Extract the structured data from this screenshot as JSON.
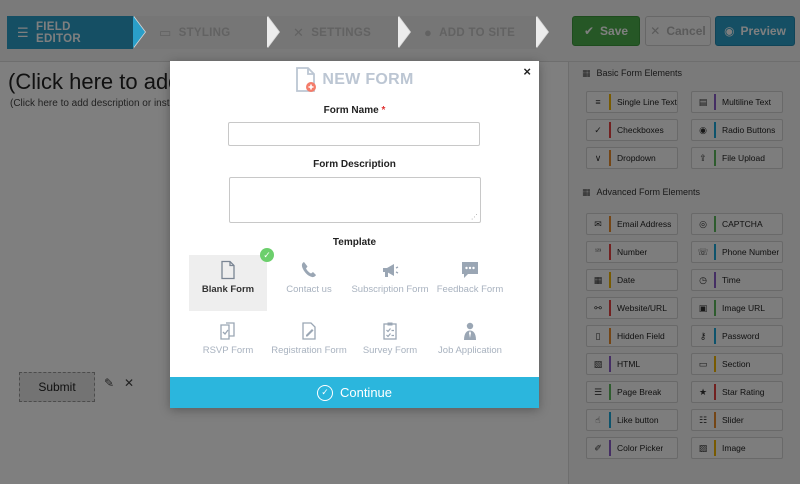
{
  "steps": [
    {
      "label": "FIELD EDITOR",
      "icon": "list-icon"
    },
    {
      "label": "STYLING",
      "icon": "paint-roller-icon"
    },
    {
      "label": "SETTINGS",
      "icon": "tools-icon"
    },
    {
      "label": "ADD TO SITE",
      "icon": "globe-icon"
    }
  ],
  "buttons": {
    "save": "Save",
    "cancel": "Cancel",
    "preview": "Preview"
  },
  "canvas": {
    "title": "(Click here to add",
    "description": "(Click here to add description or inst",
    "submit_label": "Submit"
  },
  "sidebar": {
    "basic_title": "Basic Form Elements",
    "basic": [
      {
        "label": "Single Line Text",
        "icon": "lines-icon",
        "color": "#f0b400"
      },
      {
        "label": "Multiline Text",
        "icon": "paragraph-icon",
        "color": "#8a5cc8"
      },
      {
        "label": "Checkboxes",
        "icon": "check-icon",
        "color": "#e54040"
      },
      {
        "label": "Radio Buttons",
        "icon": "radio-icon",
        "color": "#1aa6d9"
      },
      {
        "label": "Dropdown",
        "icon": "chevron-down-icon",
        "color": "#e88a2a"
      },
      {
        "label": "File Upload",
        "icon": "upload-icon",
        "color": "#5cb85c"
      }
    ],
    "advanced_title": "Advanced Form Elements",
    "advanced": [
      {
        "label": "Email Address",
        "icon": "envelope-icon",
        "color": "#e88a2a"
      },
      {
        "label": "CAPTCHA",
        "icon": "eye-icon",
        "color": "#5cb85c"
      },
      {
        "label": "Number",
        "icon": "number-icon",
        "color": "#e54040"
      },
      {
        "label": "Phone Number",
        "icon": "phone-icon",
        "color": "#1aa6d9"
      },
      {
        "label": "Date",
        "icon": "calendar-icon",
        "color": "#f0b400"
      },
      {
        "label": "Time",
        "icon": "clock-icon",
        "color": "#8a5cc8"
      },
      {
        "label": "Website/URL",
        "icon": "link-icon",
        "color": "#e54040"
      },
      {
        "label": "Image URL",
        "icon": "image-icon",
        "color": "#5cb85c"
      },
      {
        "label": "Hidden Field",
        "icon": "hidden-icon",
        "color": "#e88a2a"
      },
      {
        "label": "Password",
        "icon": "key-icon",
        "color": "#1aa6d9"
      },
      {
        "label": "HTML",
        "icon": "html-icon",
        "color": "#8a5cc8"
      },
      {
        "label": "Section",
        "icon": "section-icon",
        "color": "#f0b400"
      },
      {
        "label": "Page Break",
        "icon": "page-break-icon",
        "color": "#5cb85c"
      },
      {
        "label": "Star Rating",
        "icon": "star-icon",
        "color": "#e54040"
      },
      {
        "label": "Like button",
        "icon": "thumbs-up-icon",
        "color": "#1aa6d9"
      },
      {
        "label": "Slider",
        "icon": "slider-icon",
        "color": "#e88a2a"
      },
      {
        "label": "Color Picker",
        "icon": "eyedropper-icon",
        "color": "#8a5cc8"
      },
      {
        "label": "Image",
        "icon": "picture-icon",
        "color": "#f0b400"
      }
    ]
  },
  "modal": {
    "title": "NEW FORM",
    "close": "×",
    "form_name_label": "Form Name",
    "required_mark": "*",
    "form_description_label": "Form Description",
    "template_label": "Template",
    "templates": [
      {
        "label": "Blank Form",
        "icon": "blank-form-icon",
        "selected": true
      },
      {
        "label": "Contact us",
        "icon": "phone-icon",
        "selected": false
      },
      {
        "label": "Subscription Form",
        "icon": "megaphone-icon",
        "selected": false
      },
      {
        "label": "Feedback Form",
        "icon": "feedback-icon",
        "selected": false
      },
      {
        "label": "RSVP Form",
        "icon": "rsvp-icon",
        "selected": false
      },
      {
        "label": "Registration Form",
        "icon": "registration-icon",
        "selected": false
      },
      {
        "label": "Survey Form",
        "icon": "survey-icon",
        "selected": false
      },
      {
        "label": "Job Application",
        "icon": "job-icon",
        "selected": false
      }
    ],
    "continue_label": "Continue"
  },
  "colors": {
    "accent": "#2a9fc9",
    "continue": "#2bb6dd",
    "save": "#4cae4c",
    "check": "#6ccf6c"
  }
}
